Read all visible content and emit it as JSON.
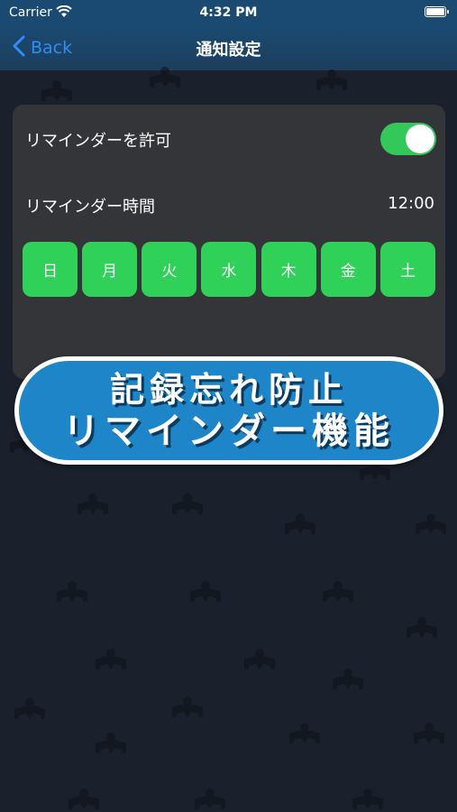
{
  "status_bar": {
    "carrier": "Carrier",
    "time": "4:32 PM"
  },
  "nav": {
    "back_label": "Back",
    "title": "通知設定"
  },
  "settings": {
    "allow_reminder_label": "リマインダーを許可",
    "allow_reminder_on": true,
    "reminder_time_label": "リマインダー時間",
    "reminder_time_value": "12:00",
    "days": [
      "日",
      "月",
      "火",
      "水",
      "木",
      "金",
      "土"
    ]
  },
  "banner": {
    "line1": "記録忘れ防止",
    "line2": "リマインダー機能"
  },
  "colors": {
    "toggle_on": "#34c759",
    "day_button": "#30d158",
    "banner": "#1e86c8",
    "nav_link": "#2f8df5"
  }
}
